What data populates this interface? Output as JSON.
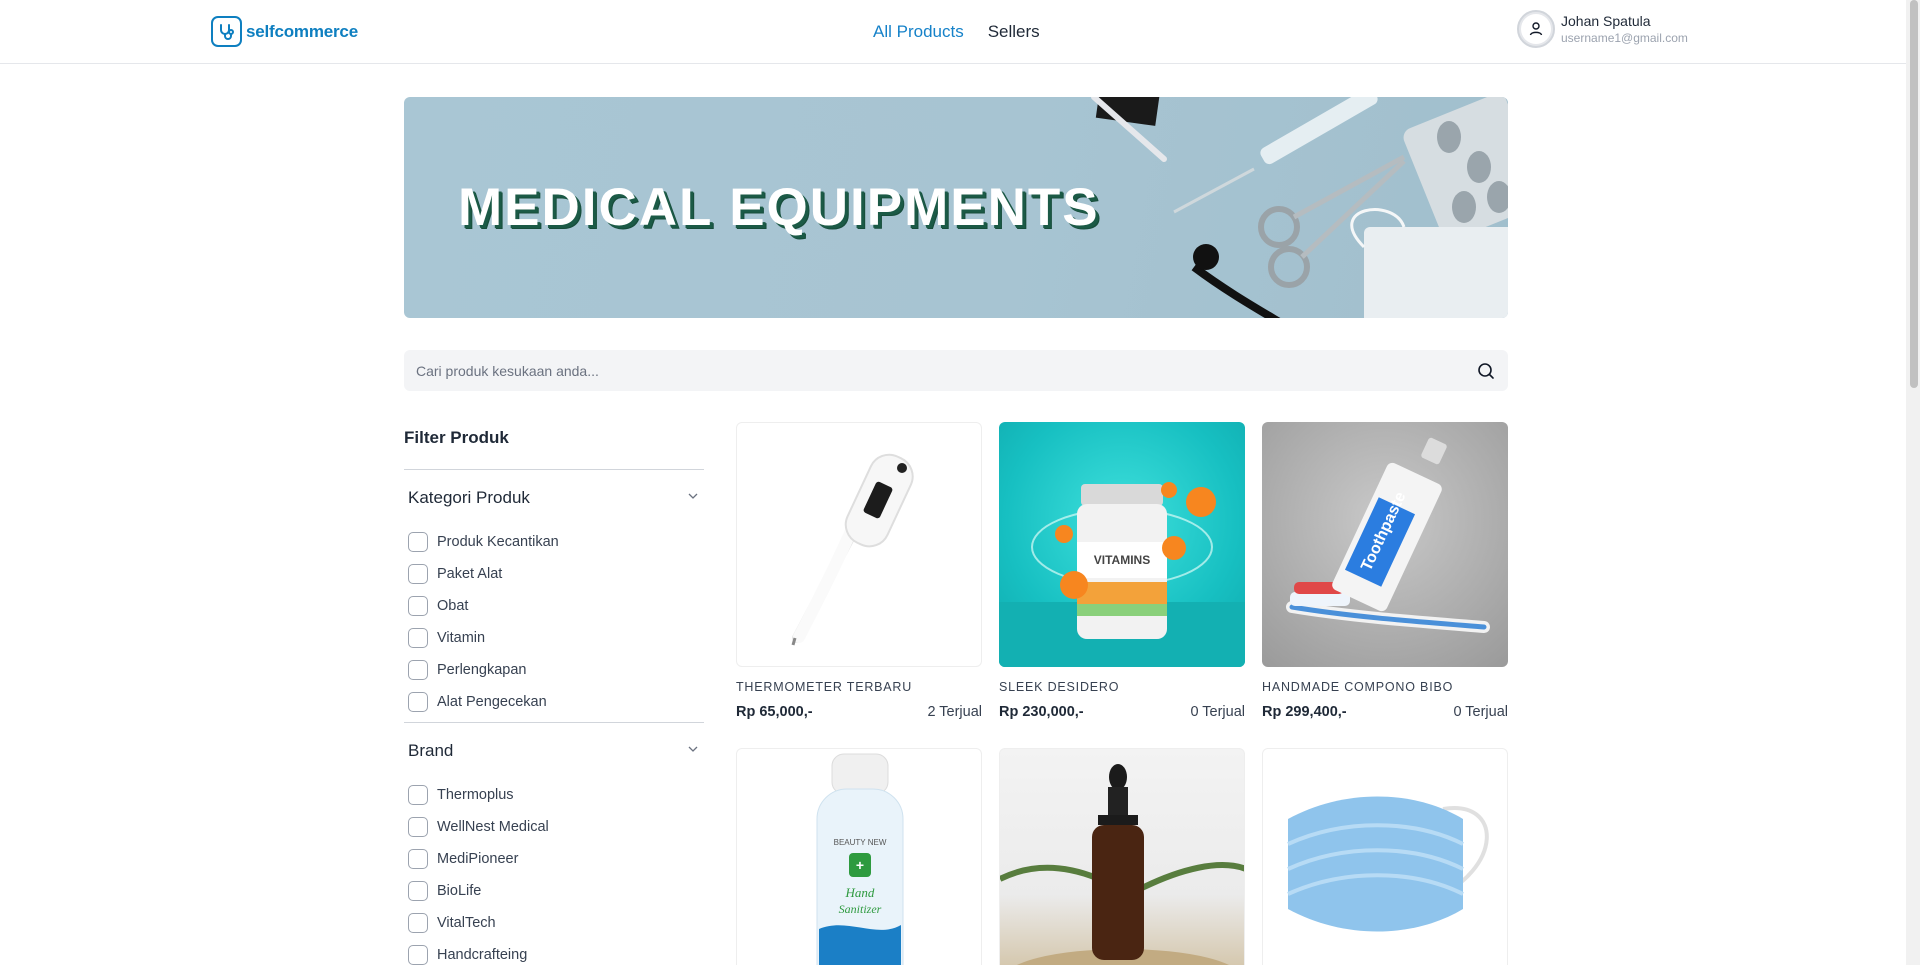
{
  "header": {
    "logo_text": "selfcommerce",
    "nav": [
      {
        "label": "All Products",
        "active": true
      },
      {
        "label": "Sellers",
        "active": false
      }
    ],
    "user": {
      "name": "Johan Spatula",
      "email": "username1@gmail.com"
    }
  },
  "banner": {
    "title": "MEDICAL EQUIPMENTS"
  },
  "search": {
    "placeholder": "Cari produk kesukaan anda..."
  },
  "filter": {
    "title": "Filter Produk",
    "sections": [
      {
        "label": "Kategori Produk",
        "options": [
          "Produk Kecantikan",
          "Paket Alat",
          "Obat",
          "Vitamin",
          "Perlengkapan",
          "Alat Pengecekan"
        ]
      },
      {
        "label": "Brand",
        "options": [
          "Thermoplus",
          "WellNest Medical",
          "MediPioneer",
          "BioLife",
          "VitalTech",
          "Handcrafteing"
        ]
      }
    ]
  },
  "products": [
    {
      "name": "THERMOMETER TERBARU",
      "price": "Rp 65,000,-",
      "sold": "2 Terjual",
      "image_icon": "thermometer-image"
    },
    {
      "name": "SLEEK DESIDERO",
      "price": "Rp 230,000,-",
      "sold": "0 Terjual",
      "image_icon": "vitamins-image"
    },
    {
      "name": "HANDMADE COMPONO BIBO",
      "price": "Rp 299,400,-",
      "sold": "0 Terjual",
      "image_icon": "toothpaste-image"
    },
    {
      "name": "",
      "price": "",
      "sold": "",
      "image_icon": "hand-sanitizer-image"
    },
    {
      "name": "",
      "price": "",
      "sold": "",
      "image_icon": "dropper-bottle-image"
    },
    {
      "name": "",
      "price": "",
      "sold": "",
      "image_icon": "face-mask-image"
    }
  ],
  "colors": {
    "brand": "#0e7fc0",
    "nav_active": "#1682c9",
    "vitamin_bg": "#17c0c2"
  }
}
